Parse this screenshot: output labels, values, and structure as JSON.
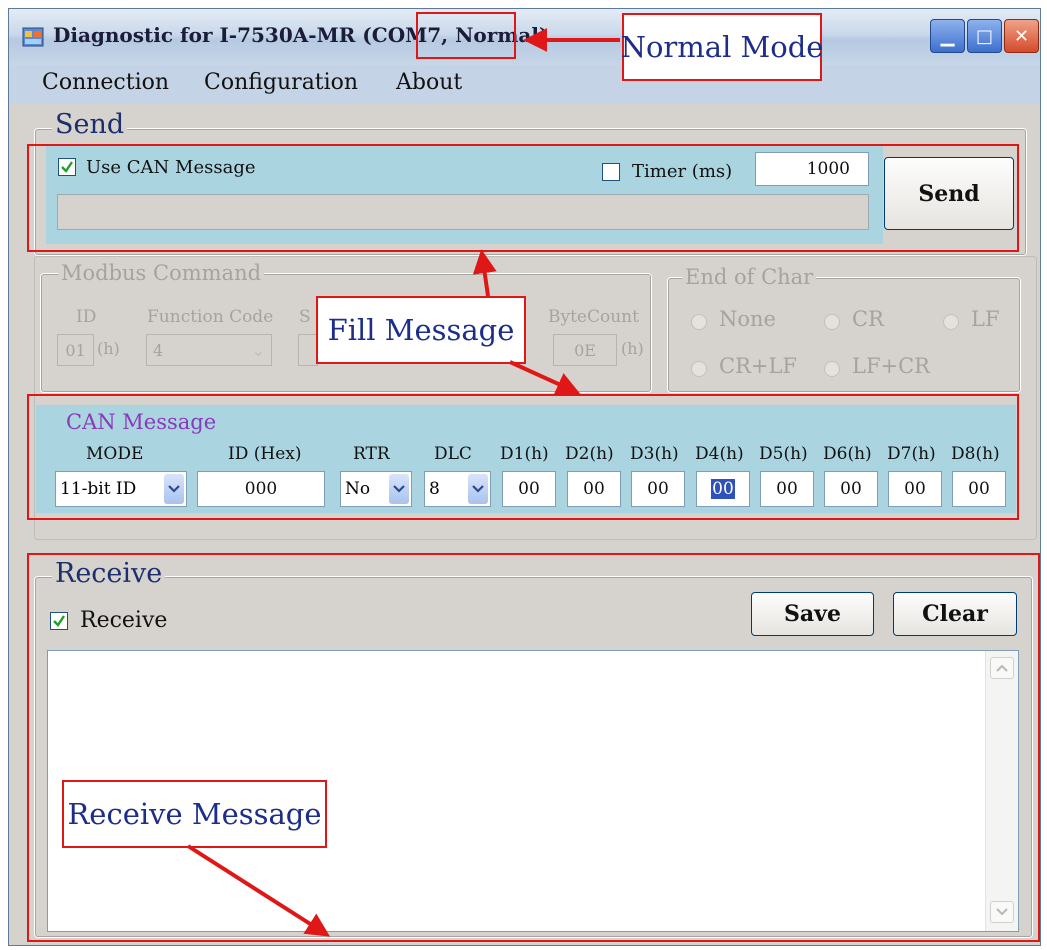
{
  "window": {
    "title": "Diagnostic for I-7530A-MR (COM7, Normal)"
  },
  "menu": [
    "Connection",
    "Configuration",
    "About"
  ],
  "send": {
    "legend": "Send",
    "use_can_label": "Use CAN Message",
    "use_can_checked": true,
    "timer_label": "Timer (ms)",
    "timer_checked": false,
    "timer_value": "1000",
    "message_value": "",
    "send_button": "Send"
  },
  "modbus": {
    "legend": "Modbus Command",
    "id_label": "ID",
    "id_value": "01",
    "id_unit": "(h)",
    "function_label": "Function Code",
    "function_value": "4",
    "start_label": "S",
    "bytecount_label": "ByteCount",
    "bytecount_value": "0E",
    "bytecount_unit": "(h)"
  },
  "end_of_char": {
    "legend": "End of Char",
    "options": [
      "None",
      "CR",
      "LF",
      "CR+LF",
      "LF+CR"
    ]
  },
  "can": {
    "title": "CAN Message",
    "headers": {
      "mode": "MODE",
      "id": "ID (Hex)",
      "rtr": "RTR",
      "dlc": "DLC",
      "d": [
        "D1(h)",
        "D2(h)",
        "D3(h)",
        "D4(h)",
        "D5(h)",
        "D6(h)",
        "D7(h)",
        "D8(h)"
      ]
    },
    "mode_value": "11-bit ID",
    "id_value": "000",
    "rtr_value": "No",
    "dlc_value": "8",
    "data": [
      "00",
      "00",
      "00",
      "00",
      "00",
      "00",
      "00",
      "00"
    ],
    "selected_index": 3
  },
  "receive": {
    "legend": "Receive",
    "checkbox_label": "Receive",
    "checked": true,
    "save_button": "Save",
    "clear_button": "Clear",
    "log_text": ""
  },
  "annotations": {
    "normal_mode": "Normal Mode",
    "fill_message": "Fill Message",
    "receive_message": "Receive Message"
  },
  "colors": {
    "annotation": "#e01717",
    "panel": "#a9d4e0",
    "can_title": "#8a3ab9"
  }
}
